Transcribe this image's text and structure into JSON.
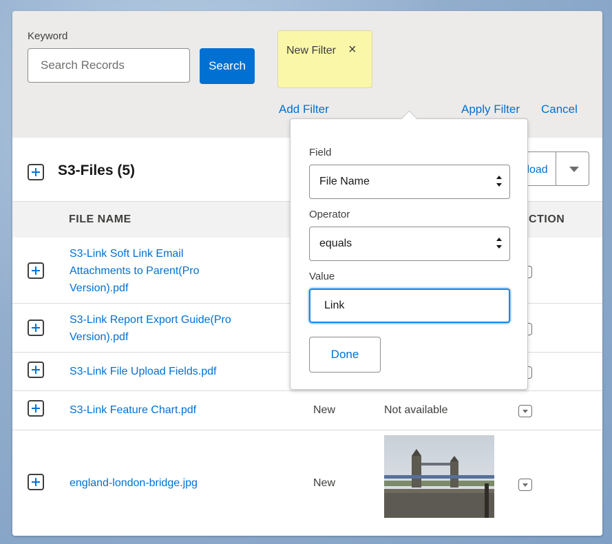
{
  "filter_bar": {
    "keyword_label": "Keyword",
    "search_placeholder": "Search Records",
    "search_button": "Search",
    "filter_chip_label": "New Filter",
    "add_filter": "Add Filter",
    "apply_filter": "Apply Filter",
    "cancel": "Cancel"
  },
  "popover": {
    "field_label": "Field",
    "field_value": "File Name",
    "operator_label": "Operator",
    "operator_value": "equals",
    "value_label": "Value",
    "value": "Link",
    "done_button": "Done"
  },
  "object": {
    "title": "S3-Files (5)",
    "upload_button": "Upload"
  },
  "table": {
    "columns": [
      "FILE NAME",
      "ACTION"
    ],
    "rows": [
      {
        "name": "S3-Link Soft Link Email Attachments to Parent(Pro Version).pdf"
      },
      {
        "name": "S3-Link Report Export Guide(Pro Version).pdf"
      },
      {
        "name": "S3-Link File Upload Fields.pdf"
      },
      {
        "name": "S3-Link Feature Chart.pdf",
        "status": "New",
        "preview": "Not available"
      },
      {
        "name": "england-london-bridge.jpg",
        "status": "New"
      }
    ]
  },
  "icons": {
    "close": "close-icon",
    "expand": "plus-square-icon",
    "dropdown": "chevron-down-icon",
    "select": "up-down-arrows-icon"
  },
  "colors": {
    "brand": "#0070d2",
    "filter_chip": "#faf7a9",
    "panel": "#ecebea"
  }
}
